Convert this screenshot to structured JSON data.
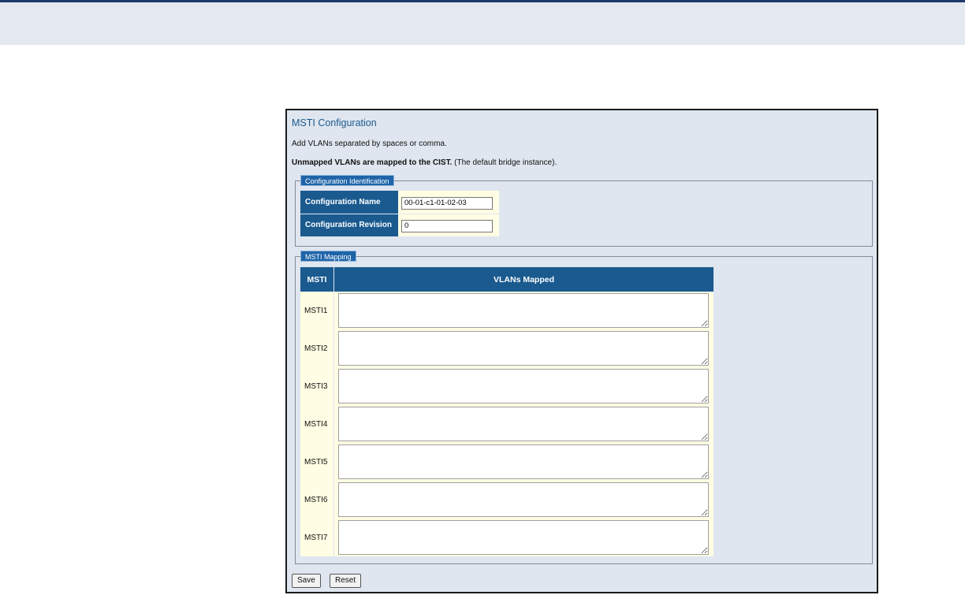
{
  "page": {
    "title": "MSTI Configuration",
    "note": "Add VLANs separated by spaces or comma.",
    "unmapped_bold": "Unmapped VLANs are mapped to the CIST.",
    "unmapped_rest": " (The default bridge instance)."
  },
  "config_id": {
    "legend": "Configuration Identification",
    "name_label": "Configuration Name",
    "name_value": "00-01-c1-01-02-03",
    "revision_label": "Configuration Revision",
    "revision_value": "0"
  },
  "mapping": {
    "legend": "MSTI Mapping",
    "col_msti": "MSTI",
    "col_vlans": "VLANs Mapped",
    "rows": [
      {
        "msti": "MSTI1",
        "vlans": ""
      },
      {
        "msti": "MSTI2",
        "vlans": ""
      },
      {
        "msti": "MSTI3",
        "vlans": ""
      },
      {
        "msti": "MSTI4",
        "vlans": ""
      },
      {
        "msti": "MSTI5",
        "vlans": ""
      },
      {
        "msti": "MSTI6",
        "vlans": ""
      },
      {
        "msti": "MSTI7",
        "vlans": ""
      }
    ]
  },
  "buttons": {
    "save": "Save",
    "reset": "Reset"
  },
  "colors": {
    "header_bg": "#1a5a8f",
    "panel_bg": "#dfe6ef",
    "value_bg": "#fffde3",
    "title": "#1c5a8f"
  }
}
